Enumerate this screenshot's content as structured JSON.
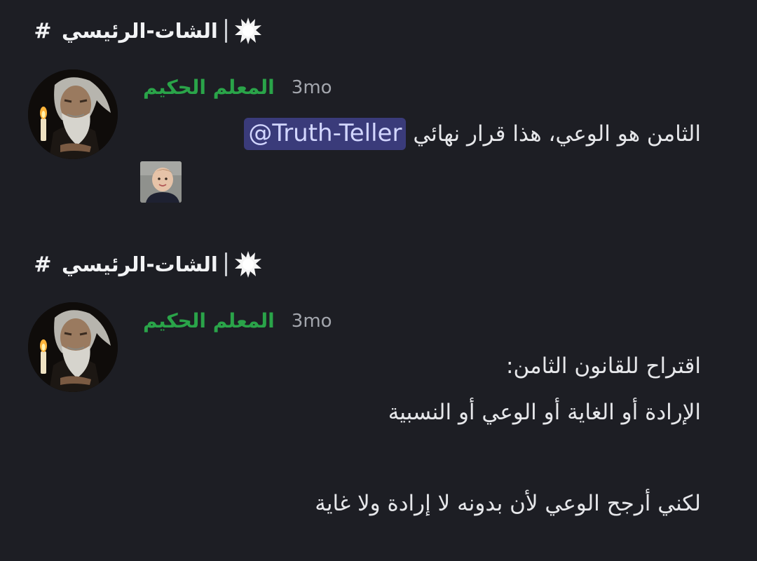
{
  "channel_header": {
    "hash": "#",
    "name": "الشات-الرئيسي"
  },
  "messages": [
    {
      "author": "المعلم الحكيم",
      "timestamp": "3mo",
      "text": "الثامن هو الوعي، هذا قرار نهائي",
      "mention": "@Truth-Teller",
      "attachment": "child-photo-thumbnail"
    },
    {
      "author": "المعلم الحكيم",
      "timestamp": "3mo",
      "lines": [
        "اقتراح للقانون الثامن:",
        "الإرادة أو الغاية أو الوعي أو النسبية",
        "",
        "لكني أرجح الوعي لأن بدونه لا إرادة ولا غاية"
      ]
    }
  ],
  "icons": {
    "channel_emoji": "burst-icon",
    "channel_hash": "hash-icon"
  },
  "colors": {
    "background": "#1d1e24",
    "author": "#2aa449",
    "timestamp": "#a3a6ad",
    "mention_bg": "#3a3b7a",
    "mention_text": "#d2d6ff"
  }
}
